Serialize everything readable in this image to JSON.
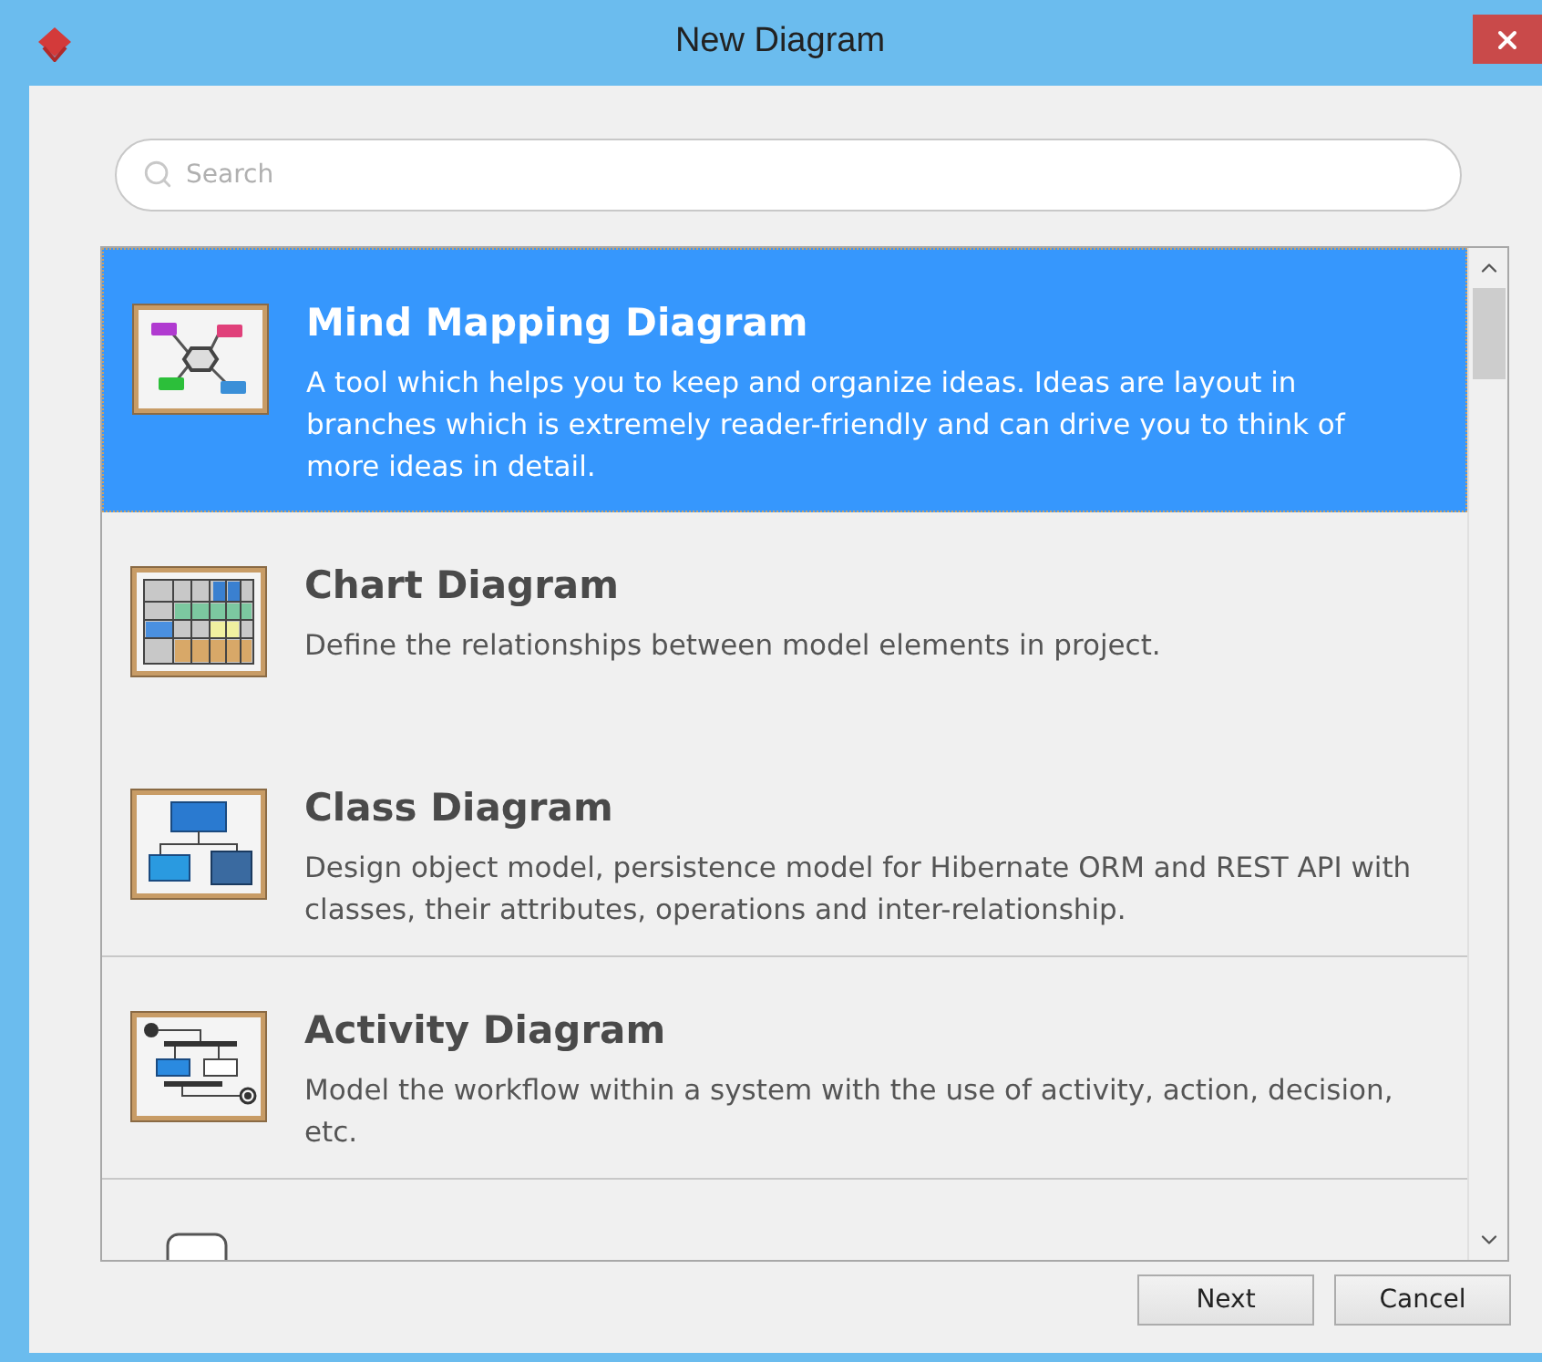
{
  "window": {
    "title": "New Diagram"
  },
  "search": {
    "placeholder": "Search"
  },
  "items": [
    {
      "kind": "mind-map",
      "selected": true,
      "title": "Mind Mapping Diagram",
      "description": "A tool which helps you to keep and organize ideas. Ideas are layout in branches which is extremely reader-friendly and can drive you to think of more ideas in detail."
    },
    {
      "kind": "chart",
      "selected": false,
      "title": "Chart Diagram",
      "description": "Define the relationships between model elements in project."
    },
    {
      "kind": "class",
      "selected": false,
      "title": "Class Diagram",
      "description": "Design object model, persistence model for Hibernate ORM and REST API with classes, their attributes, operations and inter-relationship."
    },
    {
      "kind": "activity",
      "selected": false,
      "title": "Activity Diagram",
      "description": "Model the workflow within a system with the use of activity, action, decision, etc."
    },
    {
      "kind": "phone",
      "selected": false
    }
  ],
  "buttons": [
    "Next",
    "Cancel"
  ]
}
